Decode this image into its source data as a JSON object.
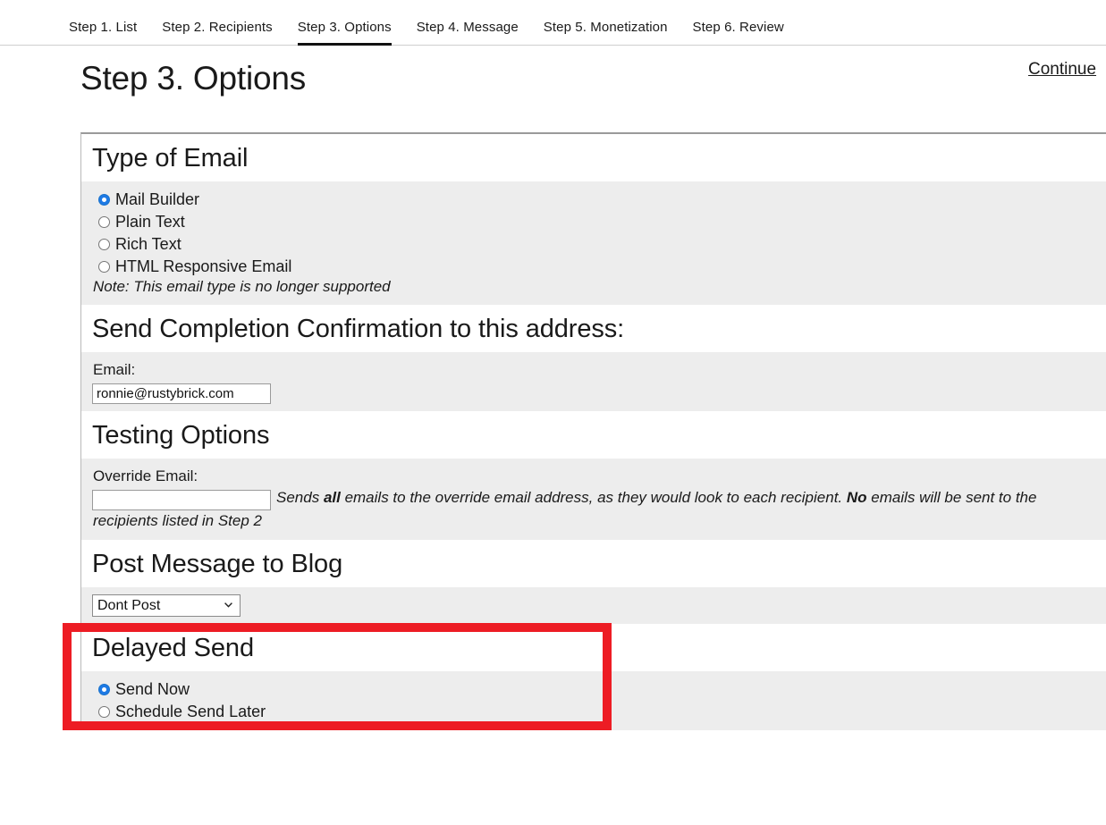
{
  "tabs": [
    {
      "label": "Step 1. List",
      "active": false
    },
    {
      "label": "Step 2. Recipients",
      "active": false
    },
    {
      "label": "Step 3. Options",
      "active": true
    },
    {
      "label": "Step 4. Message",
      "active": false
    },
    {
      "label": "Step 5. Monetization",
      "active": false
    },
    {
      "label": "Step 6. Review",
      "active": false
    }
  ],
  "header": {
    "title": "Step 3. Options",
    "continue_label": "Continue"
  },
  "sections": {
    "type_of_email": {
      "title": "Type of Email",
      "options": [
        {
          "label": "Mail Builder",
          "selected": true
        },
        {
          "label": "Plain Text",
          "selected": false
        },
        {
          "label": "Rich Text",
          "selected": false
        },
        {
          "label": "HTML Responsive Email",
          "selected": false
        }
      ],
      "note": "Note: This email type is no longer supported"
    },
    "confirmation": {
      "title": "Send Completion Confirmation to this address:",
      "email_label": "Email:",
      "email_value": "ronnie@rustybrick.com"
    },
    "testing": {
      "title": "Testing Options",
      "override_label": "Override Email:",
      "override_value": "",
      "helper_pre": "Sends ",
      "helper_bold1": "all",
      "helper_mid": " emails to the override email address, as they would look to each recipient. ",
      "helper_bold2": "No",
      "helper_post": " emails will be sent to the",
      "helper_line2": "recipients listed in Step 2"
    },
    "post_to_blog": {
      "title": "Post Message to Blog",
      "selected_option": "Dont Post",
      "options": [
        "Dont Post"
      ]
    },
    "delayed_send": {
      "title": "Delayed Send",
      "options": [
        {
          "label": "Send Now",
          "selected": true
        },
        {
          "label": "Schedule Send Later",
          "selected": false
        }
      ]
    }
  },
  "colors": {
    "highlight": "#ed1c24",
    "radio_accent": "#1e7ae5",
    "row_bg": "#ededed"
  }
}
